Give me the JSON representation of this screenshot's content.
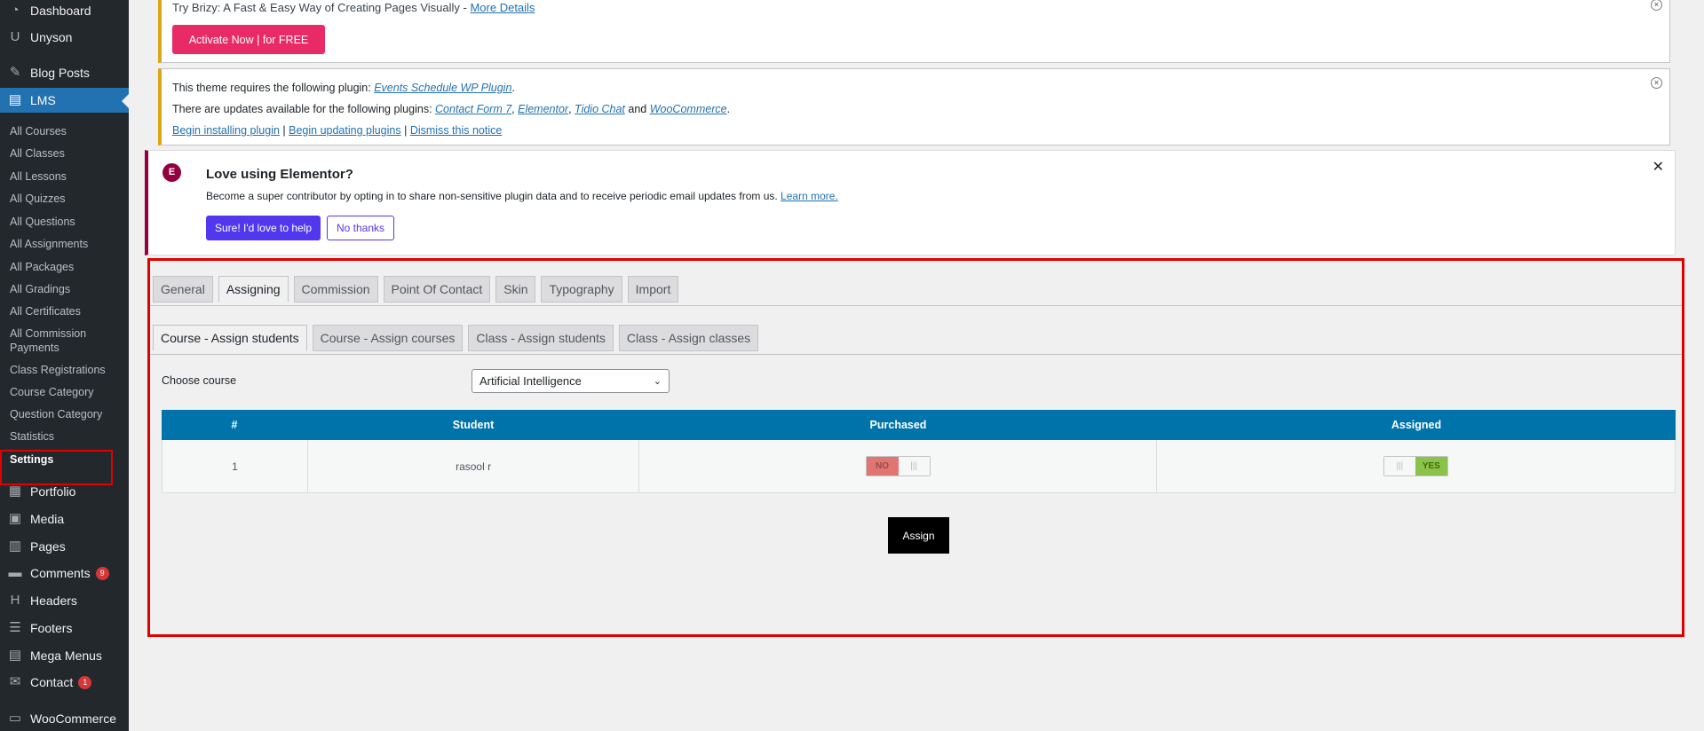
{
  "sidebar": {
    "items_top": [
      {
        "label": "Dashboard",
        "icon": "dashboard-icon",
        "glyph": "◔"
      },
      {
        "label": "Unyson",
        "icon": "unyson-icon",
        "glyph": "U"
      },
      {
        "label": "Blog Posts",
        "icon": "pin-icon",
        "glyph": "✎"
      },
      {
        "label": "LMS",
        "icon": "lms-icon",
        "glyph": "▤"
      }
    ],
    "lms_sub": [
      "All Courses",
      "All Classes",
      "All Lessons",
      "All Quizzes",
      "All Questions",
      "All Assignments",
      "All Packages",
      "All Gradings",
      "All Certificates",
      "All Commission Payments",
      "Class Registrations",
      "Course Category",
      "Question Category",
      "Statistics",
      "Settings"
    ],
    "items_bottom": [
      {
        "label": "Portfolio",
        "icon": "portfolio-icon",
        "glyph": "▦"
      },
      {
        "label": "Media",
        "icon": "media-icon",
        "glyph": "▣"
      },
      {
        "label": "Pages",
        "icon": "pages-icon",
        "glyph": "▥"
      },
      {
        "label": "Comments",
        "icon": "comments-icon",
        "glyph": "▬",
        "count": "9"
      },
      {
        "label": "Headers",
        "icon": "headers-icon",
        "glyph": "H"
      },
      {
        "label": "Footers",
        "icon": "footers-icon",
        "glyph": "☰"
      },
      {
        "label": "Mega Menus",
        "icon": "mega-menus-icon",
        "glyph": "▤"
      },
      {
        "label": "Contact",
        "icon": "mail-icon",
        "glyph": "✉",
        "count": "1"
      },
      {
        "label": "WooCommerce",
        "icon": "woocommerce-icon",
        "glyph": "▭"
      }
    ]
  },
  "notice_brizy": {
    "text": "Try Brizy: A Fast & Easy Way of Creating Pages Visually - ",
    "link": "More Details",
    "button": "Activate Now | for FREE",
    "close": "×"
  },
  "notice_plugins": {
    "line1_prefix": "This theme requires the following plugin: ",
    "line1_link": "Events Schedule WP Plugin",
    "line1_suffix": ".",
    "line2_prefix": "There are updates available for the following plugins: ",
    "line2_links": [
      "Contact Form 7",
      "Elementor",
      "Tidio Chat",
      "WooCommerce"
    ],
    "line2_sep": ", ",
    "line2_and": " and ",
    "line2_suffix": ".",
    "actions": [
      "Begin installing plugin",
      "Begin updating plugins",
      "Dismiss this notice"
    ],
    "actions_sep": " | ",
    "close": "×"
  },
  "elementor_notice": {
    "logo": "E",
    "title": "Love using Elementor?",
    "desc": "Become a super contributor by opting in to share non-sensitive plugin data and to receive periodic email updates from us. ",
    "learn_more": "Learn more.",
    "accept": "Sure! I'd love to help",
    "decline": "No thanks",
    "close": "✕"
  },
  "settings": {
    "tabs": [
      "General",
      "Assigning",
      "Commission",
      "Point Of Contact",
      "Skin",
      "Typography",
      "Import"
    ],
    "active_tab": 1,
    "subtabs": [
      "Course - Assign students",
      "Course - Assign courses",
      "Class - Assign students",
      "Class - Assign classes"
    ],
    "active_subtab": 0,
    "choose_course_label": "Choose course",
    "selected_course": "Artificial Intelligence",
    "table": {
      "headers": [
        "#",
        "Student",
        "Purchased",
        "Assigned"
      ],
      "rows": [
        {
          "num": "1",
          "student": "rasool r",
          "purchased": "NO",
          "assigned": "YES"
        }
      ]
    },
    "assign_button": "Assign",
    "toggle_knob": "|||"
  }
}
